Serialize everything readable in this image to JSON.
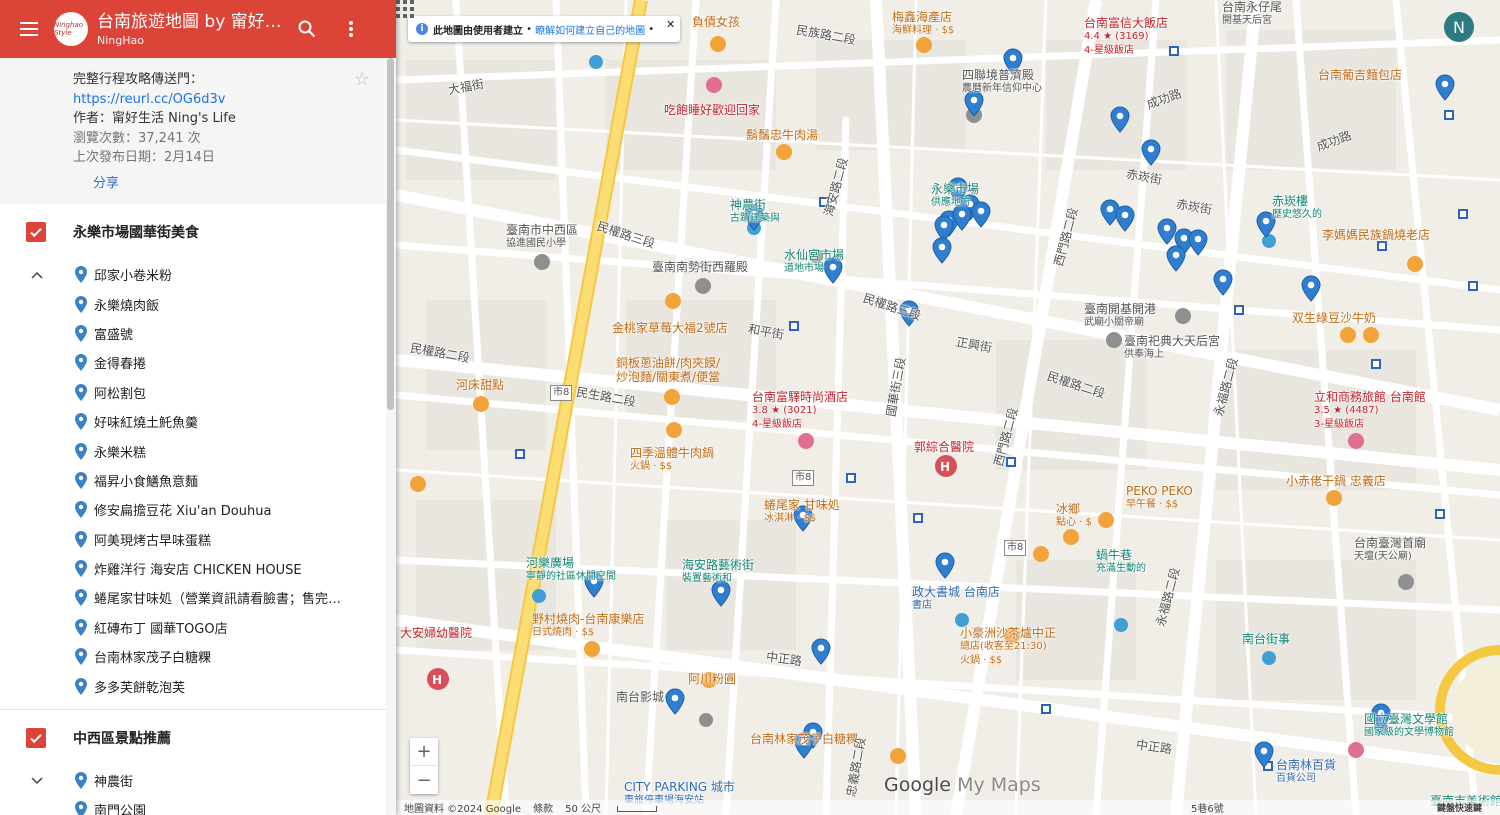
{
  "header": {
    "menu_icon": "hamburger-menu-icon",
    "logo_text": "Ninghao Style",
    "title": "台南旅遊地圖 by 甯好生活 Ning's Life",
    "author": "NingHao"
  },
  "info": {
    "line1": "完整行程攻略傳送門：",
    "link": "https://reurl.cc/OG6d3v",
    "author": "作者：甯好生活 Ning's Life",
    "views": "瀏覽次數：37,241 次",
    "published": "上次發布日期：2月14日",
    "share": "分享"
  },
  "layers": [
    {
      "name": "永樂市場國華街美食",
      "expanded": true,
      "items": [
        "邱家小卷米粉",
        "永樂燒肉飯",
        "富盛號",
        "金得春捲",
        "阿松割包",
        "好味紅燒土魠魚羹",
        "永樂米糕",
        "福昇小食鱔魚意麵",
        "修安扁擔豆花 Xiu'an Douhua",
        "阿美現烤古早味蛋糕",
        "炸雞洋行 海安店 CHICKEN HOUSE",
        "蜷尾家甘味処（營業資訊請看臉書；售完為止）",
        "紅磚布丁 國華TOGO店",
        "台南林家茂子白糖粿",
        "多多芙餅乾泡芙"
      ]
    },
    {
      "name": "中西區景點推薦",
      "expanded": false,
      "items": [
        "神農街",
        "南門公園"
      ]
    }
  ],
  "map": {
    "notice": "此地圖由使用者建立",
    "notice_link": "瞭解如何建立自己的地圖",
    "user_initial": "N",
    "zoom_in": "+",
    "zoom_out": "−",
    "attribution": "地圖資料 ©2024 Google",
    "terms": "條款",
    "scale": "50 公尺",
    "address": "5巷6號",
    "shortcuts": "鍵盤快速鍵",
    "watermark_google": "Google",
    "watermark_mymaps": "My Maps",
    "labels": [
      {
        "text": "負債女孩",
        "kind": "food"
      },
      {
        "text": "梅鑫海產店",
        "sub": "海鮮料理 · $$",
        "kind": "food"
      },
      {
        "text": "台南富信大飯店",
        "sub": "4.4 ★ (3169)",
        "sub2": "4-星級飯店",
        "kind": "hotel"
      },
      {
        "text": "台南永仔尾",
        "sub": "開基天后宮",
        "kind": "gray"
      },
      {
        "text": "台南葡吉麵包店",
        "kind": "food"
      },
      {
        "text": "吃飽睡好歡迎回家",
        "kind": "hotel"
      },
      {
        "text": "四聯境普濟殿",
        "sub": "農曆新年信仰中心",
        "kind": "gray"
      },
      {
        "text": "鬍鬚忠牛肉湯",
        "kind": "food"
      },
      {
        "text": "永樂市場",
        "sub": "供應地方",
        "kind": "teal"
      },
      {
        "text": "神農街",
        "sub": "古蹟建築與",
        "kind": "teal"
      },
      {
        "text": "臺南市中西區",
        "sub": "協進國民小學",
        "kind": "gray"
      },
      {
        "text": "水仙宮市場",
        "sub": "道地市場",
        "kind": "teal"
      },
      {
        "text": "赤崁樓",
        "sub": "歷史悠久的",
        "kind": "teal"
      },
      {
        "text": "李媽媽民族鍋燒老店",
        "kind": "food"
      },
      {
        "text": "臺南南勢街西羅殿",
        "kind": "gray"
      },
      {
        "text": "金桃家草莓大福2號店",
        "kind": "food"
      },
      {
        "text": "臺南開基開港",
        "sub": "武廟小關帝廟",
        "kind": "gray"
      },
      {
        "text": "臺南祀典大天后宮",
        "sub": "供奉海上",
        "kind": "gray"
      },
      {
        "text": "双生綠豆沙牛奶",
        "kind": "food"
      },
      {
        "text": "銅板蔥油餅/肉夾饃/",
        "sub": "炒泡麵/關東煮/便當",
        "kind": "food"
      },
      {
        "text": "河床甜點",
        "kind": "food"
      },
      {
        "text": "台南富驛時尚酒店",
        "sub": "3.8 ★ (3021)",
        "sub2": "4-星級飯店",
        "kind": "hotel"
      },
      {
        "text": "立和商務旅館 台南館",
        "sub": "3.5 ★ (4487)",
        "sub2": "3-星級飯店",
        "kind": "hotel"
      },
      {
        "text": "四季溫體牛肉鍋",
        "sub": "火鍋 · $$",
        "kind": "food"
      },
      {
        "text": "郭綜合醫院",
        "kind": "hotel"
      },
      {
        "text": "蜷尾家 甘味処",
        "sub": "冰淇淋 · $$",
        "kind": "food"
      },
      {
        "text": "冰鄉",
        "sub": "點心 · $",
        "kind": "food"
      },
      {
        "text": "PEKO PEKO",
        "sub": "早午餐 · $$",
        "kind": "food"
      },
      {
        "text": "小赤佬干鍋 忠義店",
        "kind": "food"
      },
      {
        "text": "台南臺灣首廟",
        "sub": "天壇(天公廟)",
        "kind": "gray"
      },
      {
        "text": "河樂廣場",
        "sub": "寧靜的社區休閒空間",
        "kind": "teal"
      },
      {
        "text": "海安路藝術街",
        "sub": "裝置藝術和",
        "kind": "teal"
      },
      {
        "text": "政大書城 台南店",
        "sub": "書店",
        "kind": "blue"
      },
      {
        "text": "蝸牛巷",
        "sub": "充滿生動的",
        "kind": "teal"
      },
      {
        "text": "南台街事",
        "kind": "teal"
      },
      {
        "text": "野村燒肉-台南康樂店",
        "sub": "日式燒肉 · $$",
        "kind": "food"
      },
      {
        "text": "大安婦幼醫院",
        "kind": "hotel"
      },
      {
        "text": "小豪洲沙茶爐中正",
        "sub": "總店(收客至21:30)",
        "sub2": "火鍋 · $$",
        "kind": "food"
      },
      {
        "text": "阿川粉圓",
        "kind": "food"
      },
      {
        "text": "南台影城",
        "kind": "gray"
      },
      {
        "text": "台南林家茂子白糖粿",
        "kind": "food"
      },
      {
        "text": "國立臺灣文學館",
        "sub": "國家級的文學博物館",
        "kind": "teal"
      },
      {
        "text": "台南林百貨",
        "sub": "百貨公司",
        "kind": "blue"
      },
      {
        "text": "CITY PARKING 城市",
        "sub": "車旅停車場海安站",
        "kind": "blue"
      },
      {
        "text": "臺南市美術館",
        "kind": "teal"
      },
      {
        "text": "民權路三段",
        "kind": "road"
      },
      {
        "text": "民權路二段",
        "kind": "road"
      },
      {
        "text": "民生路二段",
        "kind": "road"
      },
      {
        "text": "中正路",
        "kind": "road"
      },
      {
        "text": "海安路二段",
        "kind": "road"
      },
      {
        "text": "西門路二段",
        "kind": "road"
      },
      {
        "text": "永福路二段",
        "kind": "road"
      },
      {
        "text": "成功路",
        "kind": "road"
      },
      {
        "text": "和平街",
        "kind": "road"
      },
      {
        "text": "國華街三段",
        "kind": "road"
      },
      {
        "text": "大福街",
        "kind": "road"
      },
      {
        "text": "民族路二段",
        "kind": "road"
      },
      {
        "text": "忠義路二段",
        "kind": "road"
      },
      {
        "text": "赤崁街",
        "kind": "road"
      },
      {
        "text": "正興街",
        "kind": "road"
      },
      {
        "text": "市8",
        "kind": "road"
      }
    ]
  },
  "colors": {
    "brand_red": "#db4437",
    "pin_blue": "#3b82c4",
    "major_road": "#f6d35b",
    "accent_link": "#1a73e8"
  }
}
